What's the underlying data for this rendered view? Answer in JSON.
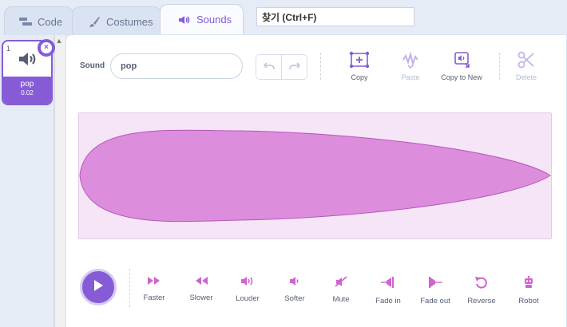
{
  "tabs": [
    {
      "label": "Code",
      "icon": "code-icon"
    },
    {
      "label": "Costumes",
      "icon": "brush-icon"
    },
    {
      "label": "Sounds",
      "icon": "speaker-icon",
      "active": true
    }
  ],
  "search": {
    "value": "찾기 (Ctrl+F)"
  },
  "sound_list": {
    "items": [
      {
        "number": "1",
        "name": "pop",
        "duration": "0.02",
        "icon": "speaker-icon",
        "selected": true
      }
    ]
  },
  "editor": {
    "sound_label": "Sound",
    "sound_name": "pop",
    "tools": [
      {
        "label": "Copy",
        "icon": "copy-icon",
        "enabled": true
      },
      {
        "label": "Paste",
        "icon": "paste-icon",
        "enabled": false
      },
      {
        "label": "Copy to New",
        "icon": "copy-to-new-icon",
        "enabled": true
      },
      {
        "label": "Delete",
        "icon": "scissors-icon",
        "enabled": false
      }
    ],
    "effects": [
      {
        "label": "Faster",
        "icon": "faster-icon"
      },
      {
        "label": "Slower",
        "icon": "slower-icon"
      },
      {
        "label": "Louder",
        "icon": "louder-icon"
      },
      {
        "label": "Softer",
        "icon": "softer-icon"
      },
      {
        "label": "Mute",
        "icon": "mute-icon"
      },
      {
        "label": "Fade in",
        "icon": "fade-in-icon"
      },
      {
        "label": "Fade out",
        "icon": "fade-out-icon"
      },
      {
        "label": "Reverse",
        "icon": "reverse-icon"
      },
      {
        "label": "Robot",
        "icon": "robot-icon"
      }
    ]
  },
  "colors": {
    "accent": "#855cd6",
    "waveform_fill": "#dc8edc",
    "waveform_bg": "#f6e5f6"
  }
}
